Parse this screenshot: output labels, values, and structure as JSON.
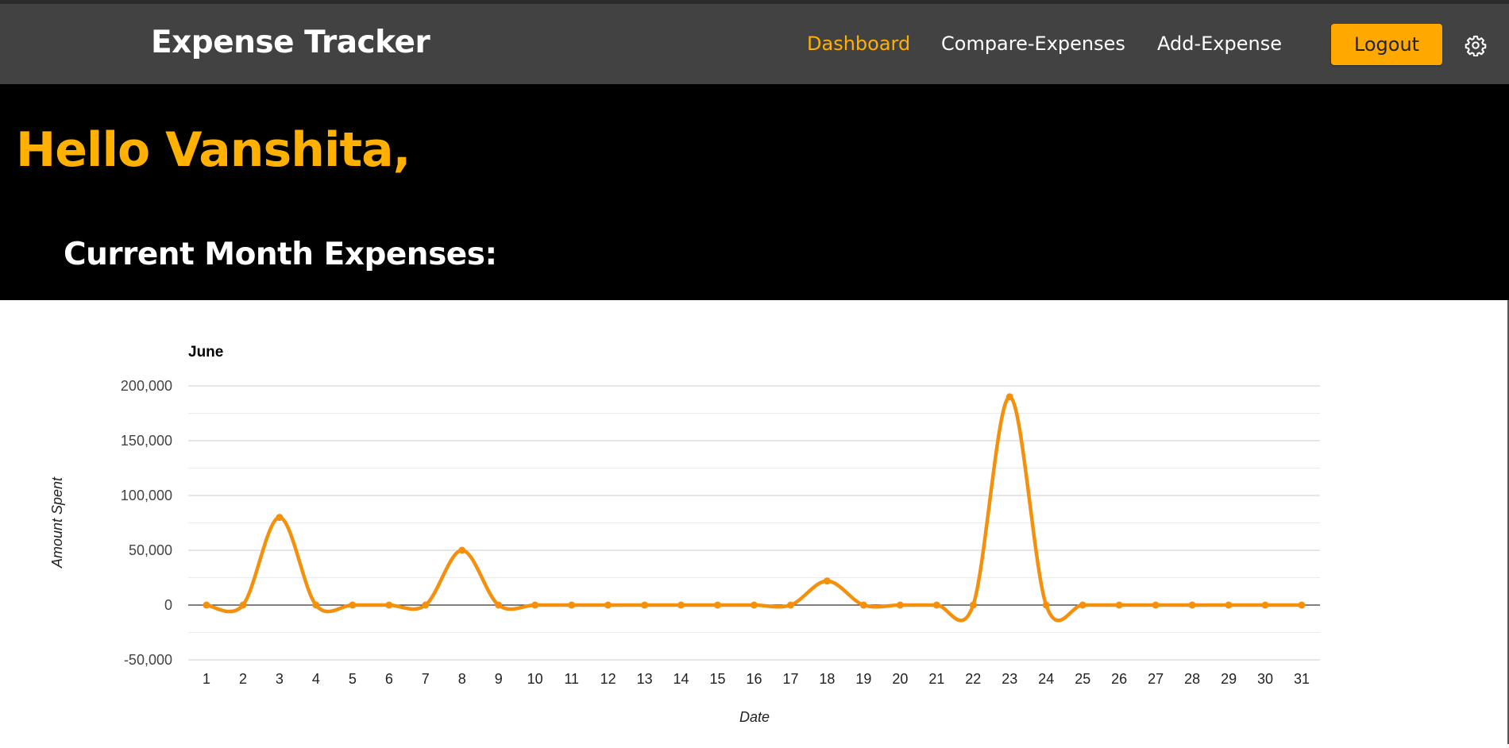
{
  "navbar": {
    "brand": "Expense Tracker",
    "links": [
      {
        "label": "Dashboard",
        "active": true
      },
      {
        "label": "Compare-Expenses",
        "active": false
      },
      {
        "label": "Add-Expense",
        "active": false
      }
    ],
    "logout_label": "Logout"
  },
  "hero": {
    "greeting": "Hello Vanshita,",
    "section_title": "Current Month Expenses:"
  },
  "colors": {
    "navbar_bg": "#424242",
    "accent": "#ffa800",
    "line": "#f4900c"
  },
  "chart_data": {
    "type": "line",
    "title": "June",
    "xlabel": "Date",
    "ylabel": "Amount Spent",
    "x": [
      1,
      2,
      3,
      4,
      5,
      6,
      7,
      8,
      9,
      10,
      11,
      12,
      13,
      14,
      15,
      16,
      17,
      18,
      19,
      20,
      21,
      22,
      23,
      24,
      25,
      26,
      27,
      28,
      29,
      30,
      31
    ],
    "y": [
      0,
      0,
      80000,
      0,
      0,
      0,
      0,
      50000,
      0,
      0,
      0,
      0,
      0,
      0,
      0,
      0,
      0,
      22000,
      0,
      0,
      0,
      0,
      190000,
      0,
      0,
      0,
      0,
      0,
      0,
      0,
      0
    ],
    "ylim": [
      -50000,
      200000
    ],
    "yticks": [
      -50000,
      0,
      50000,
      100000,
      150000,
      200000
    ],
    "ytick_labels": [
      "-50,000",
      "0",
      "50,000",
      "100,000",
      "150,000",
      "200,000"
    ],
    "smooth": true,
    "grid": true,
    "legend": "none"
  }
}
